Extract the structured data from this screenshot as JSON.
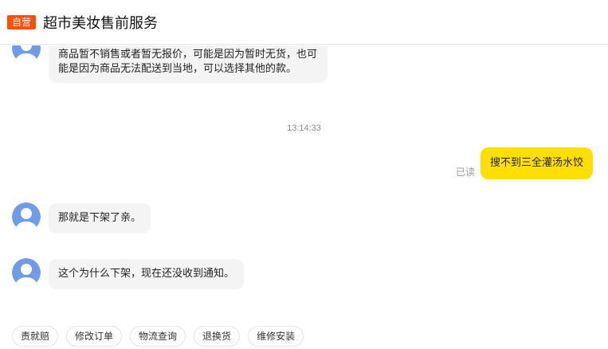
{
  "header": {
    "badge": "自营",
    "title": "超市美妆售前服务"
  },
  "messages": {
    "m1_text": "商品暂不销售或者暂无报价，可能是因为暂时无货，也可能是因为商品无法配送到当地，可以选择其他的款。",
    "timestamp": "13:14:33",
    "user_text": "搜不到三全灌汤水饺",
    "read_status": "已读",
    "m2_text": "那就是下架了亲。",
    "m3_text": "这个为什么下架，现在还没收到通知。"
  },
  "quick_replies": [
    "责就赔",
    "修改订单",
    "物流查询",
    "退换货",
    "维修安装"
  ],
  "colors": {
    "badge": "#ff5000",
    "user_bubble": "#ffdf00",
    "agent_bubble": "#f4f4f4",
    "avatar": "#6f9ce8"
  }
}
